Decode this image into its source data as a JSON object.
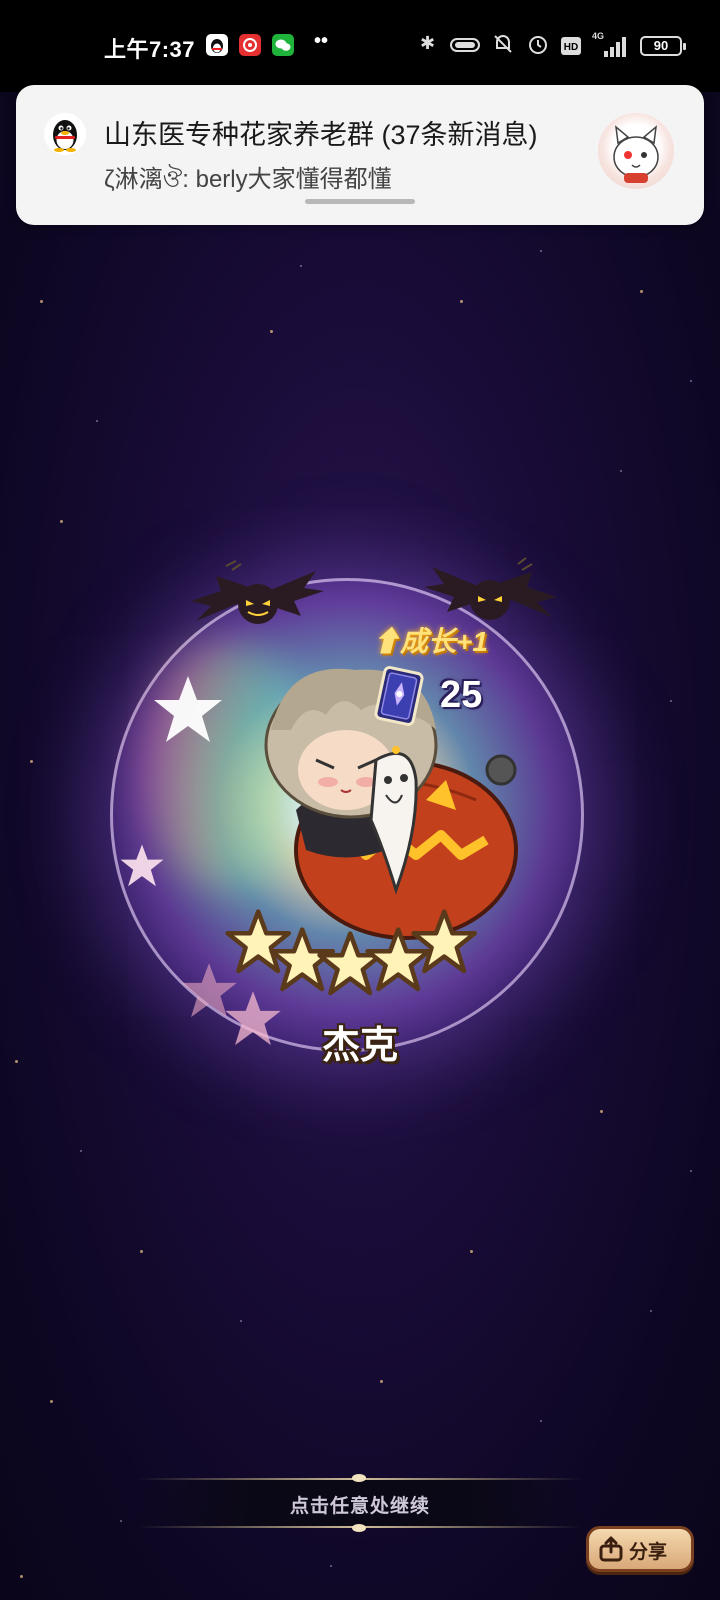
{
  "status_bar": {
    "time": "上午7:37",
    "battery": "90",
    "network": "4G",
    "icons": [
      "qq-icon",
      "netease-music-icon",
      "wechat-icon",
      "bluetooth-icon",
      "hd-icon",
      "alarm-icon",
      "mute-icon"
    ]
  },
  "notification": {
    "app_icon": "qq-penguin-icon",
    "title": "山东医专种花家养老群 (37条新消息)",
    "message": "ζ淋漓ঔ: berly大家懂得都懂"
  },
  "reward": {
    "growth_label": "⬆成长+1",
    "card_count": "25",
    "character_name": "杰克",
    "star_rating": 5
  },
  "continue_text": "点击任意处继续",
  "share_label": "分享"
}
